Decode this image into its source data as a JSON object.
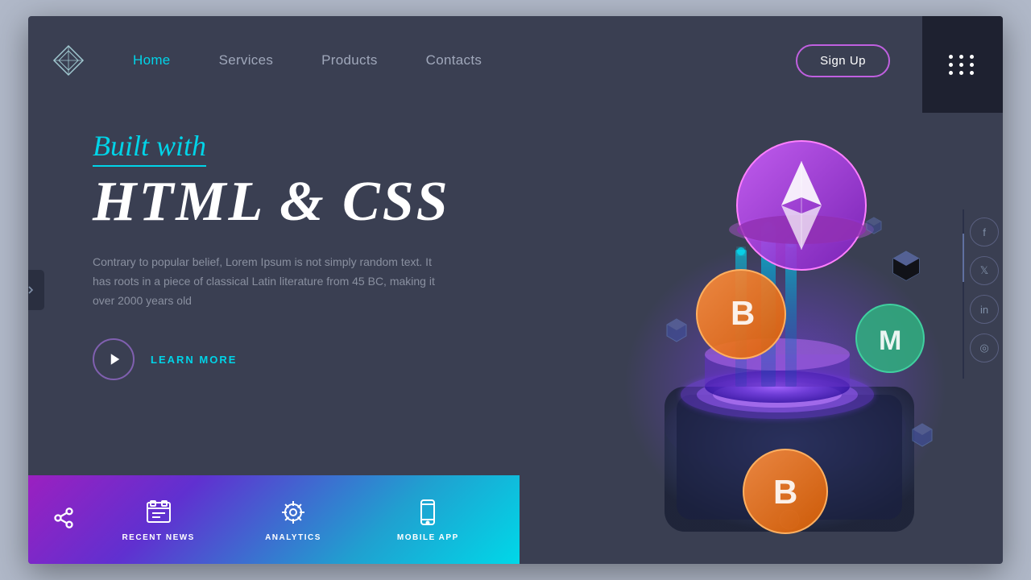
{
  "navbar": {
    "logo_alt": "diamond-logo",
    "links": [
      {
        "label": "Home",
        "active": true
      },
      {
        "label": "Services",
        "active": false
      },
      {
        "label": "Products",
        "active": false
      },
      {
        "label": "Contacts",
        "active": false
      }
    ],
    "signup_label": "Sign Up",
    "menu_icon": "grid-dots"
  },
  "hero": {
    "built_with": "Built with",
    "main_title": "HTML & CSS",
    "description": "Contrary to popular belief, Lorem Ipsum is not simply random text. It has roots in a piece of classical Latin literature from 45 BC, making it over 2000 years old",
    "cta_label": "LEARN MORE"
  },
  "bottom_bar": {
    "items": [
      {
        "label": "RECENT NEWS",
        "icon": "chat-icon"
      },
      {
        "label": "ANALYTICS",
        "icon": "gear-icon"
      },
      {
        "label": "MOBILE APP",
        "icon": "mobile-icon"
      }
    ],
    "share_icon": "share-icon"
  },
  "social": {
    "items": [
      {
        "icon": "facebook-icon",
        "label": "f"
      },
      {
        "icon": "twitter-icon",
        "label": "t"
      },
      {
        "icon": "linkedin-icon",
        "label": "in"
      },
      {
        "icon": "instagram-icon",
        "label": "ig"
      }
    ]
  },
  "scroll_indicator": {
    "icon": "chevron-right-icon"
  }
}
